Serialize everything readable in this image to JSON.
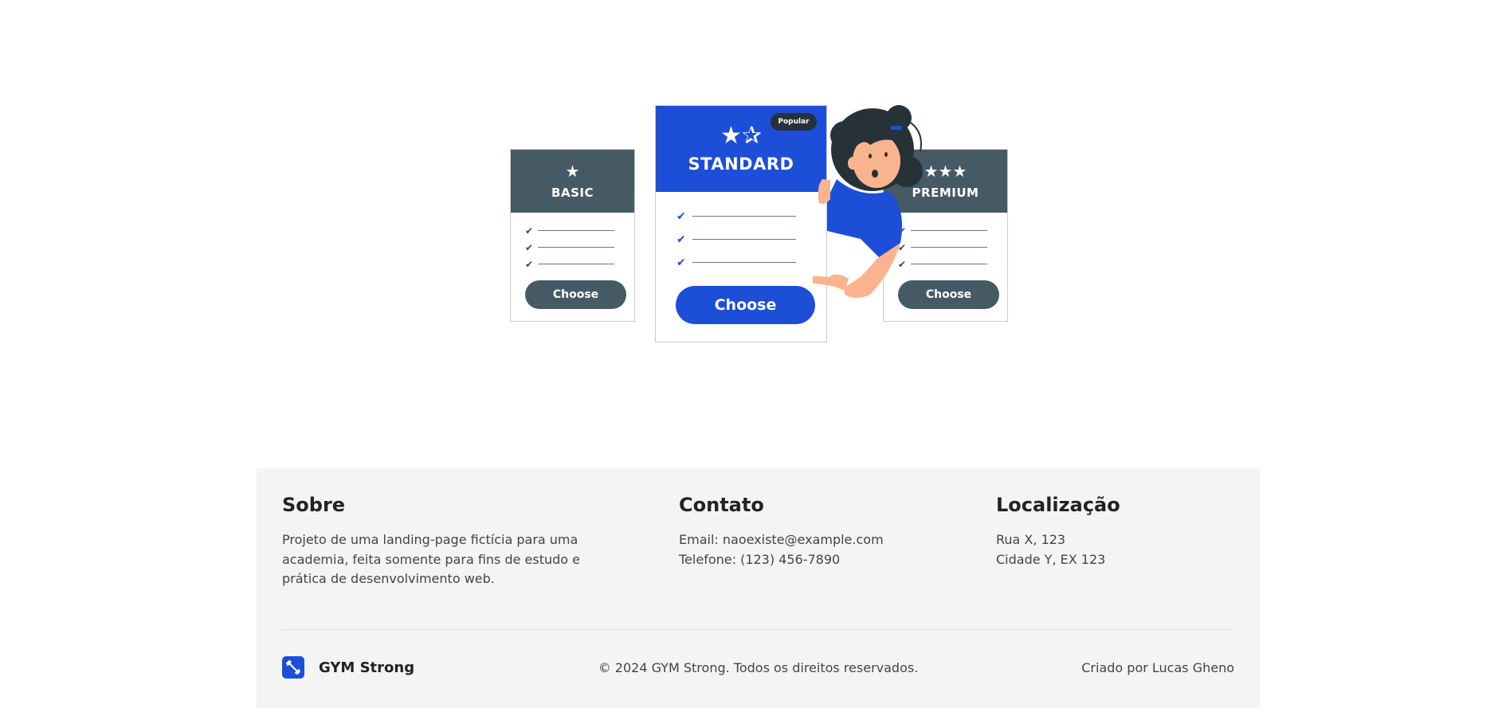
{
  "pricing_illustration": {
    "basic": {
      "title": "BASIC",
      "button": "Choose",
      "star_icon": "single-star-icon"
    },
    "standard": {
      "title": "STANDARD",
      "button": "Choose",
      "badge": "Popular",
      "star_icon": "two-stars-icon"
    },
    "premium": {
      "title": "PREMIUM",
      "button": "Choose",
      "star_icon": "three-stars-icon"
    },
    "checkmark_icon": "check-icon"
  },
  "footer": {
    "about": {
      "heading": "Sobre",
      "text": "Projeto de uma landing-page fictícia para uma academia, feita somente para fins de estudo e prática de desenvolvimento web."
    },
    "contact": {
      "heading": "Contato",
      "email": "Email: naoexiste@example.com",
      "phone": "Telefone: (123) 456-7890"
    },
    "location": {
      "heading": "Localização",
      "street": "Rua X, 123",
      "city": "Cidade Y, EX 123"
    },
    "brand": {
      "name": "GYM Strong",
      "logo_icon": "dumbbell-icon"
    },
    "copyright": "© 2024 GYM Strong. Todos os direitos reservados.",
    "credit": "Criado por Lucas Gheno"
  },
  "colors": {
    "accent_blue": "#1d4ed8",
    "slate": "#455a64",
    "footer_bg": "#f4f4f2"
  }
}
